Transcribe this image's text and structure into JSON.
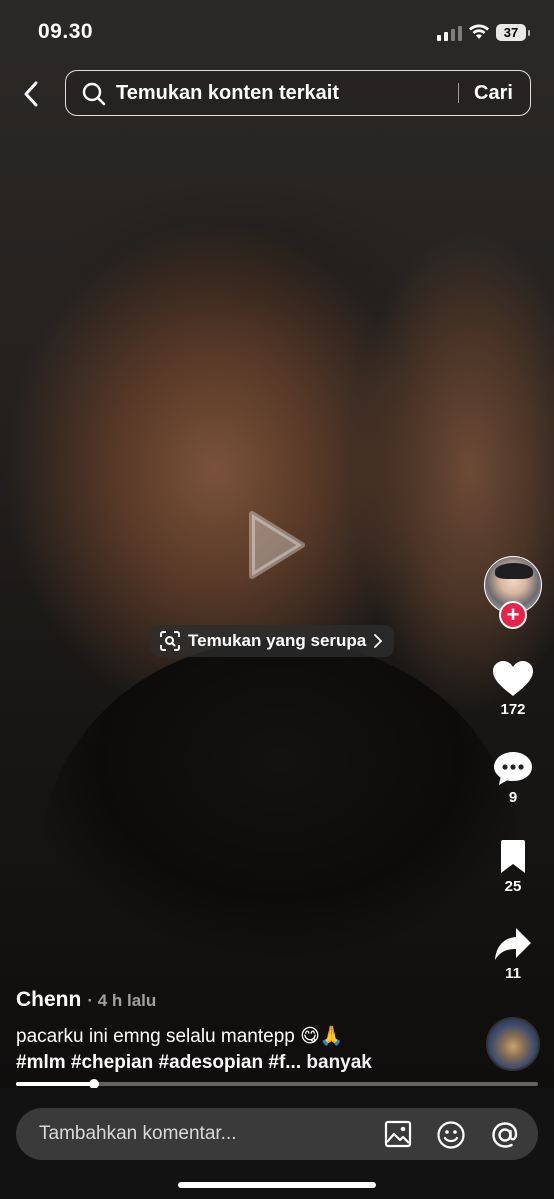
{
  "status_bar": {
    "time": "09.30",
    "battery": "37"
  },
  "search": {
    "placeholder": "Temukan konten terkait",
    "submit_label": "Cari"
  },
  "video": {
    "find_similar_label": "Temukan yang serupa"
  },
  "side_rail": {
    "like_count": "172",
    "comment_count": "9",
    "bookmark_count": "25",
    "share_count": "11"
  },
  "post": {
    "username": "Chenn",
    "time_ago": "· 4 h lalu",
    "caption": "pacarku ini emng selalu mantepp 😋🙏",
    "hashtags": "#mlm #chepian #adesopian #f...",
    "more_label": "banyak",
    "progress": 0.15
  },
  "comment": {
    "placeholder": "Tambahkan komentar..."
  },
  "icons": {
    "back": "chevron-left-icon",
    "search": "search-icon",
    "heart": "heart-icon",
    "comment": "comment-bubble-icon",
    "bookmark": "bookmark-icon",
    "share": "share-arrow-icon",
    "image": "image-icon",
    "emoji": "emoji-icon",
    "mention": "at-icon"
  },
  "colors": {
    "follow": "#e8234a",
    "background": "#0d0c0b"
  }
}
